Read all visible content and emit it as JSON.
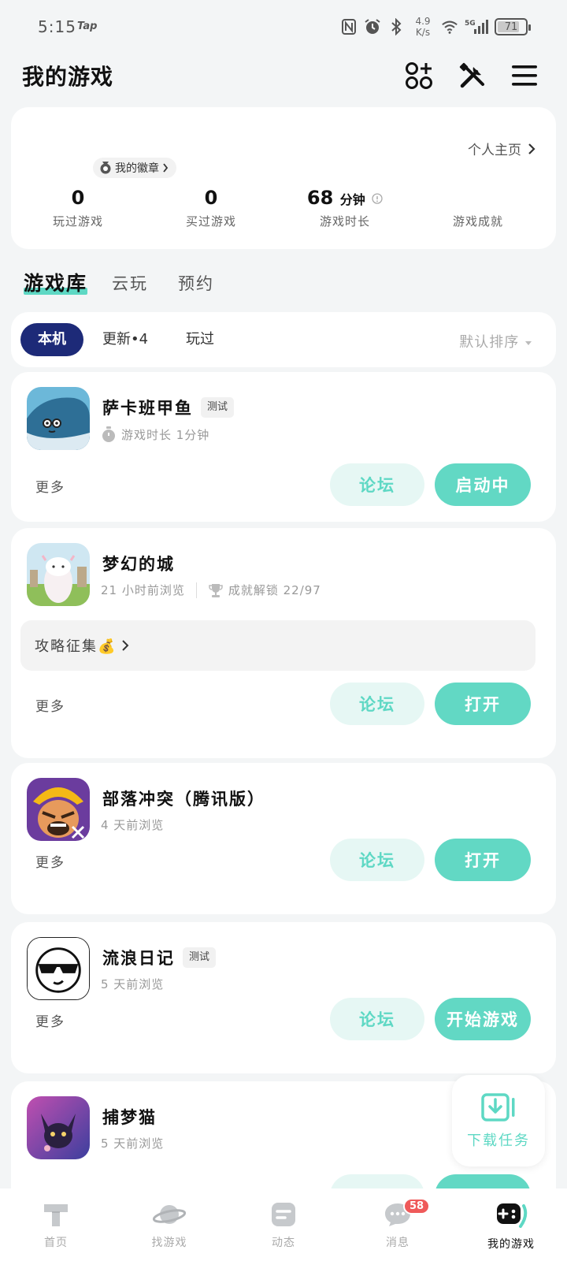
{
  "status_bar": {
    "time": "5:15",
    "app_badge": "Tap",
    "net_speed_value": "4.9",
    "net_speed_unit": "K/s",
    "network": "5G",
    "battery": "71"
  },
  "header": {
    "title": "我的游戏"
  },
  "stats": {
    "profile_link": "个人主页",
    "badge_label": "我的徽章",
    "items": [
      {
        "value": "0",
        "unit": "",
        "label": "玩过游戏"
      },
      {
        "value": "0",
        "unit": "",
        "label": "买过游戏"
      },
      {
        "value": "68",
        "unit": "分钟",
        "label": "游戏时长"
      },
      {
        "value": "",
        "unit": "",
        "label": "游戏成就"
      }
    ]
  },
  "tabs": {
    "library": "游戏库",
    "cloud": "云玩",
    "reserve": "预约"
  },
  "filters": {
    "local": "本机",
    "updates": "更新•4",
    "played": "玩过",
    "sort": "默认排序"
  },
  "games": [
    {
      "name": "萨卡班甲鱼",
      "tag": "测试",
      "meta": "游戏时长 1分钟",
      "more": "更多",
      "forum": "论坛",
      "action": "启动中"
    },
    {
      "name": "梦幻的城",
      "tag": "",
      "meta": "21 小时前浏览",
      "meta2": "成就解锁 22/97",
      "banner": "攻略征集💰",
      "more": "更多",
      "forum": "论坛",
      "action": "打开"
    },
    {
      "name": "部落冲突（腾讯版）",
      "tag": "",
      "meta": "4 天前浏览",
      "more": "更多",
      "forum": "论坛",
      "action": "打开"
    },
    {
      "name": "流浪日记",
      "tag": "测试",
      "meta": "5 天前浏览",
      "more": "更多",
      "forum": "论坛",
      "action": "开始游戏"
    },
    {
      "name": "捕梦猫",
      "tag": "",
      "meta": "5 天前浏览"
    }
  ],
  "download_task": "下载任务",
  "nav": {
    "home": "首页",
    "find": "找游戏",
    "feed": "动态",
    "messages": "消息",
    "messages_badge": "58",
    "my_games": "我的游戏"
  },
  "colors": {
    "accent": "#62d8c4",
    "accent_light": "#e6f7f4",
    "chip_active": "#1d2a78",
    "badge_red": "#ef5a5a"
  }
}
